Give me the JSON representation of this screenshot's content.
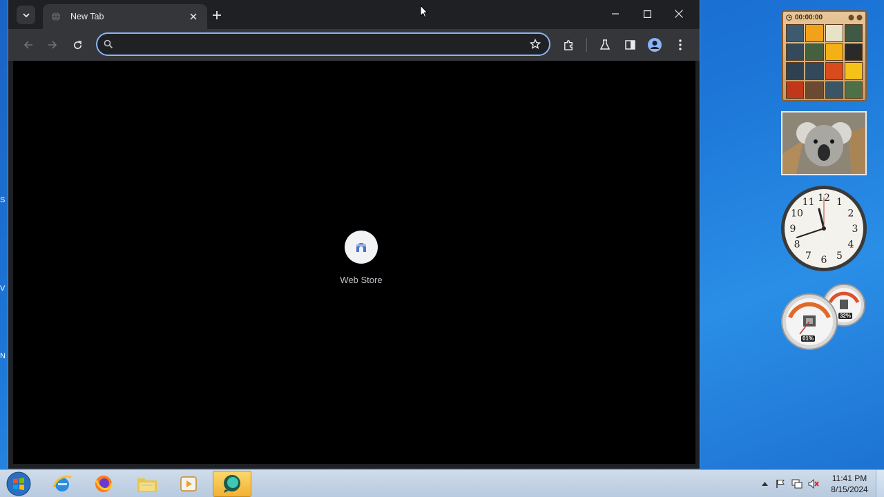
{
  "browser": {
    "tab": {
      "title": "New Tab",
      "favicon": "globe-icon"
    },
    "omnibox": {
      "value": "",
      "placeholder": ""
    },
    "shortcuts": [
      {
        "label": "Web Store",
        "icon": "web-store-icon"
      }
    ],
    "colors": {
      "accent": "#8ab4f8",
      "toolbar": "#35363a",
      "titlebar": "#1f2023"
    }
  },
  "gadgets": {
    "puzzle": {
      "timer": "00:00:00"
    },
    "clock": {
      "numerals": [
        "12",
        "1",
        "2",
        "3",
        "4",
        "5",
        "6",
        "7",
        "8",
        "9",
        "10",
        "11"
      ]
    },
    "meter": {
      "cpu": "01%",
      "memory": "32%"
    }
  },
  "taskbar": {
    "apps": [
      "internet-explorer",
      "firefox",
      "file-explorer",
      "media-player",
      "active-app"
    ],
    "time": "11:41 PM",
    "date": "8/15/2024"
  },
  "desktop": {
    "slivers": [
      "S",
      "V",
      "N"
    ]
  }
}
